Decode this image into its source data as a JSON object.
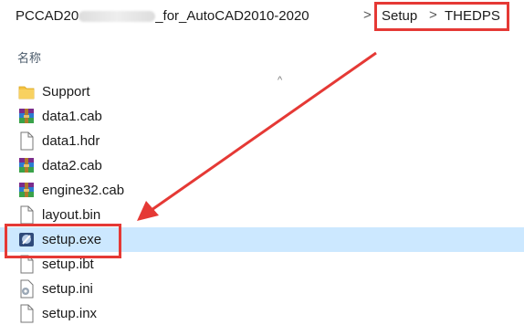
{
  "breadcrumb": {
    "path": "PCCAD20            _for_AutoCAD2010-2020",
    "items": [
      "Setup",
      "THEDPS"
    ],
    "separator": ">"
  },
  "column": {
    "name": "名称",
    "sort_indicator": "^"
  },
  "files": [
    {
      "name": "Support",
      "icon": "folder-icon"
    },
    {
      "name": "data1.cab",
      "icon": "winrar-archive-icon"
    },
    {
      "name": "data1.hdr",
      "icon": "blank-file-icon"
    },
    {
      "name": "data2.cab",
      "icon": "winrar-archive-icon"
    },
    {
      "name": "engine32.cab",
      "icon": "winrar-archive-icon"
    },
    {
      "name": "layout.bin",
      "icon": "blank-file-icon"
    },
    {
      "name": "setup.exe",
      "icon": "installer-icon"
    },
    {
      "name": "setup.ibt",
      "icon": "blank-file-icon"
    },
    {
      "name": "setup.ini",
      "icon": "settings-file-icon"
    },
    {
      "name": "setup.inx",
      "icon": "blank-file-icon"
    }
  ],
  "selected_file": "setup.exe",
  "colors": {
    "selection": "#cce8ff",
    "annotation": "#e53935",
    "folder": "#f5c342"
  }
}
